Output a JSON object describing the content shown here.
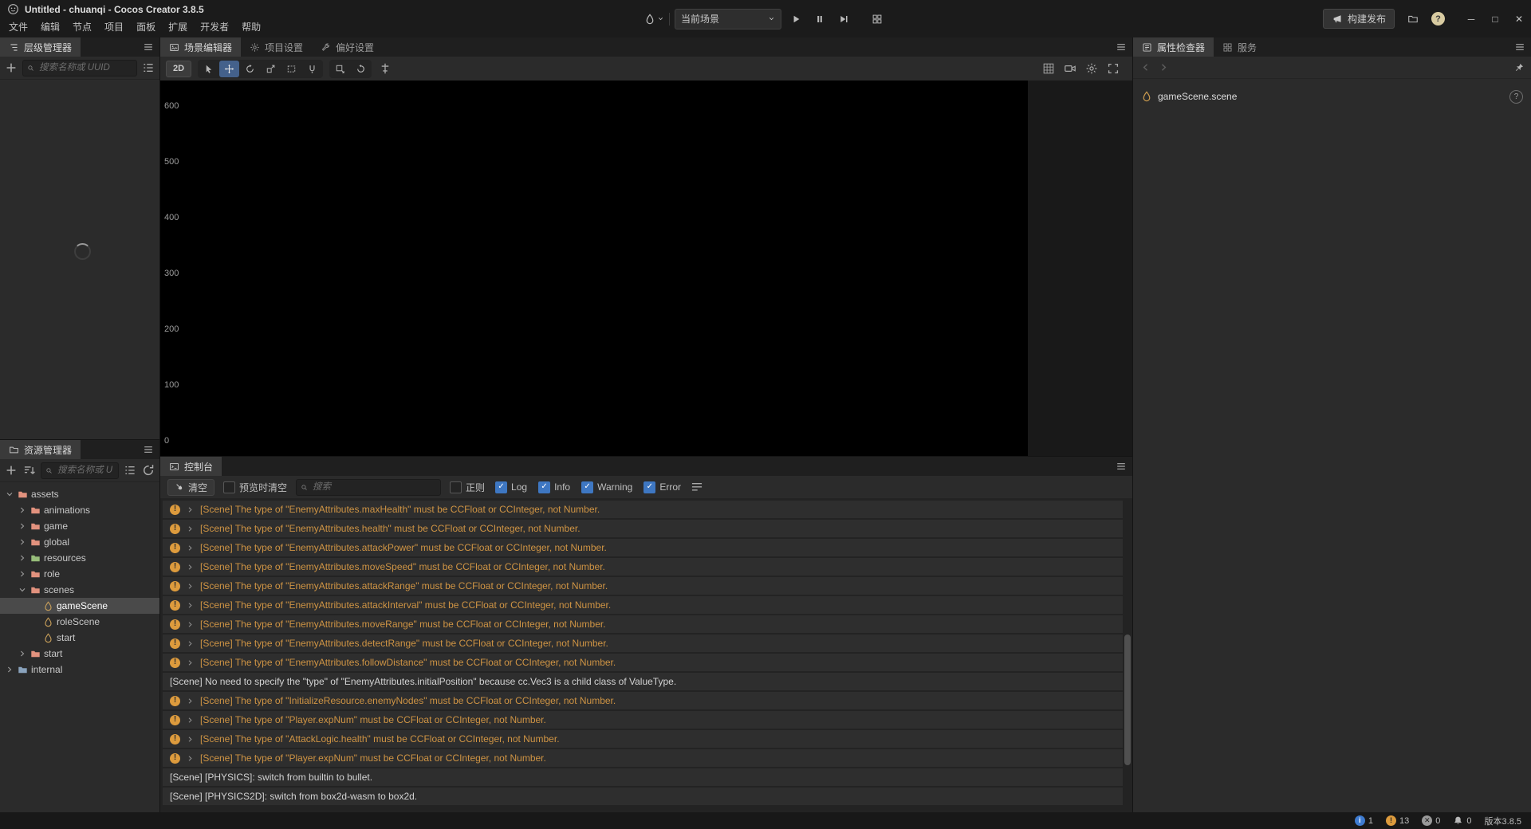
{
  "window": {
    "title": "Untitled - chuanqi - Cocos Creator 3.8.5",
    "menus": [
      {
        "label": "文件",
        "name": "file"
      },
      {
        "label": "编辑",
        "name": "edit"
      },
      {
        "label": "节点",
        "name": "node"
      },
      {
        "label": "项目",
        "name": "project"
      },
      {
        "label": "面板",
        "name": "panel"
      },
      {
        "label": "扩展",
        "name": "extension"
      },
      {
        "label": "开发者",
        "name": "developer"
      },
      {
        "label": "帮助",
        "name": "help"
      }
    ],
    "controls": {
      "minimize": "─",
      "maximize": "□",
      "close": "✕"
    }
  },
  "toolbar": {
    "scene_select": "当前场景",
    "build_label": "构建发布",
    "help_label": "?"
  },
  "hierarchy": {
    "tabs": [
      {
        "label": "层级管理器",
        "name": "hierarchy-manager",
        "icon": "hierarchyIcon",
        "active": true
      }
    ],
    "search_placeholder": "搜索名称或 UUID"
  },
  "assets": {
    "tabs": [
      {
        "label": "资源管理器",
        "name": "assets-manager",
        "icon": "folderOutline",
        "active": true
      }
    ],
    "search_placeholder": "搜索名称或 UU",
    "scene_icon_color": "#c9a05a",
    "tree": [
      {
        "label": "assets",
        "depth": 0,
        "kind": "folder",
        "arrow": "down",
        "color": "#e2927e"
      },
      {
        "label": "animations",
        "depth": 1,
        "kind": "folder",
        "arrow": "right",
        "color": "#e2927e"
      },
      {
        "label": "game",
        "depth": 1,
        "kind": "folder",
        "arrow": "right",
        "color": "#e2927e"
      },
      {
        "label": "global",
        "depth": 1,
        "kind": "folder",
        "arrow": "right",
        "color": "#e2927e"
      },
      {
        "label": "resources",
        "depth": 1,
        "kind": "folder",
        "arrow": "right",
        "color": "#97bd7a"
      },
      {
        "label": "role",
        "depth": 1,
        "kind": "folder",
        "arrow": "right",
        "color": "#e2927e"
      },
      {
        "label": "scenes",
        "depth": 1,
        "kind": "folder",
        "arrow": "down",
        "color": "#e2927e"
      },
      {
        "label": "gameScene",
        "depth": 2,
        "kind": "scene",
        "selected": true
      },
      {
        "label": "roleScene",
        "depth": 2,
        "kind": "scene"
      },
      {
        "label": "start",
        "depth": 2,
        "kind": "scene"
      },
      {
        "label": "start",
        "depth": 1,
        "kind": "folder",
        "arrow": "right",
        "color": "#e2927e"
      },
      {
        "label": "internal",
        "depth": 0,
        "kind": "folder",
        "arrow": "right",
        "color": "#8aa3bd"
      }
    ]
  },
  "scene": {
    "tabs": [
      {
        "label": "场景编辑器",
        "name": "scene-editor",
        "icon": "sceneTab",
        "active": true
      },
      {
        "label": "项目设置",
        "name": "project-settings",
        "icon": "gear"
      },
      {
        "label": "偏好设置",
        "name": "preferences",
        "icon": "wrench"
      }
    ],
    "mode_2d": "2D",
    "ruler": [
      "600",
      "500",
      "400",
      "300",
      "200",
      "100",
      "0"
    ]
  },
  "console": {
    "tabs": [
      {
        "label": "控制台",
        "name": "console",
        "icon": "consoleIcon",
        "active": true
      }
    ],
    "clear_label": "清空",
    "preview_clear_label": "预览时清空",
    "search_placeholder": "搜索",
    "regex_label": "正则",
    "filters": [
      {
        "label": "Log",
        "checked": true
      },
      {
        "label": "Info",
        "checked": true
      },
      {
        "label": "Warning",
        "checked": true
      },
      {
        "label": "Error",
        "checked": true
      }
    ],
    "logs": [
      {
        "level": "warning",
        "text": "[Scene] The type of \"EnemyAttributes.maxHealth\" must be CCFloat or CCInteger, not Number."
      },
      {
        "level": "warning",
        "text": "[Scene] The type of \"EnemyAttributes.health\" must be CCFloat or CCInteger, not Number."
      },
      {
        "level": "warning",
        "text": "[Scene] The type of \"EnemyAttributes.attackPower\" must be CCFloat or CCInteger, not Number."
      },
      {
        "level": "warning",
        "text": "[Scene] The type of \"EnemyAttributes.moveSpeed\" must be CCFloat or CCInteger, not Number."
      },
      {
        "level": "warning",
        "text": "[Scene] The type of \"EnemyAttributes.attackRange\" must be CCFloat or CCInteger, not Number."
      },
      {
        "level": "warning",
        "text": "[Scene] The type of \"EnemyAttributes.attackInterval\" must be CCFloat or CCInteger, not Number."
      },
      {
        "level": "warning",
        "text": "[Scene] The type of \"EnemyAttributes.moveRange\" must be CCFloat or CCInteger, not Number."
      },
      {
        "level": "warning",
        "text": "[Scene] The type of \"EnemyAttributes.detectRange\" must be CCFloat or CCInteger, not Number."
      },
      {
        "level": "warning",
        "text": "[Scene] The type of \"EnemyAttributes.followDistance\" must be CCFloat or CCInteger, not Number."
      },
      {
        "level": "info",
        "text": "[Scene] No need to specify the \"type\" of \"EnemyAttributes.initialPosition\" because cc.Vec3 is a child class of ValueType."
      },
      {
        "level": "warning",
        "text": "[Scene] The type of \"InitializeResource.enemyNodes\" must be CCFloat or CCInteger, not Number."
      },
      {
        "level": "warning",
        "text": "[Scene] The type of \"Player.expNum\" must be CCFloat or CCInteger, not Number."
      },
      {
        "level": "warning",
        "text": "[Scene] The type of \"AttackLogic.health\" must be CCFloat or CCInteger, not Number."
      },
      {
        "level": "warning",
        "text": "[Scene] The type of \"Player.expNum\" must be CCFloat or CCInteger, not Number."
      },
      {
        "level": "info",
        "text": "[Scene] [PHYSICS]: switch from builtin to bullet."
      },
      {
        "level": "info",
        "text": "[Scene] [PHYSICS2D]: switch from box2d-wasm to box2d."
      }
    ]
  },
  "inspector": {
    "tabs": [
      {
        "label": "属性检查器",
        "name": "inspector",
        "icon": "inspectorIcon",
        "active": true
      },
      {
        "label": "服务",
        "name": "services",
        "icon": "squares"
      }
    ],
    "asset_name": "gameScene.scene"
  },
  "status": {
    "info_count": "1",
    "warning_count": "13",
    "error_count": "0",
    "notification_count": "0",
    "version": "版本3.8.5"
  },
  "colors": {
    "accent_blue": "#3e77c2",
    "warning_orange": "#cf9444",
    "selected_row": "#4a4a4a"
  }
}
